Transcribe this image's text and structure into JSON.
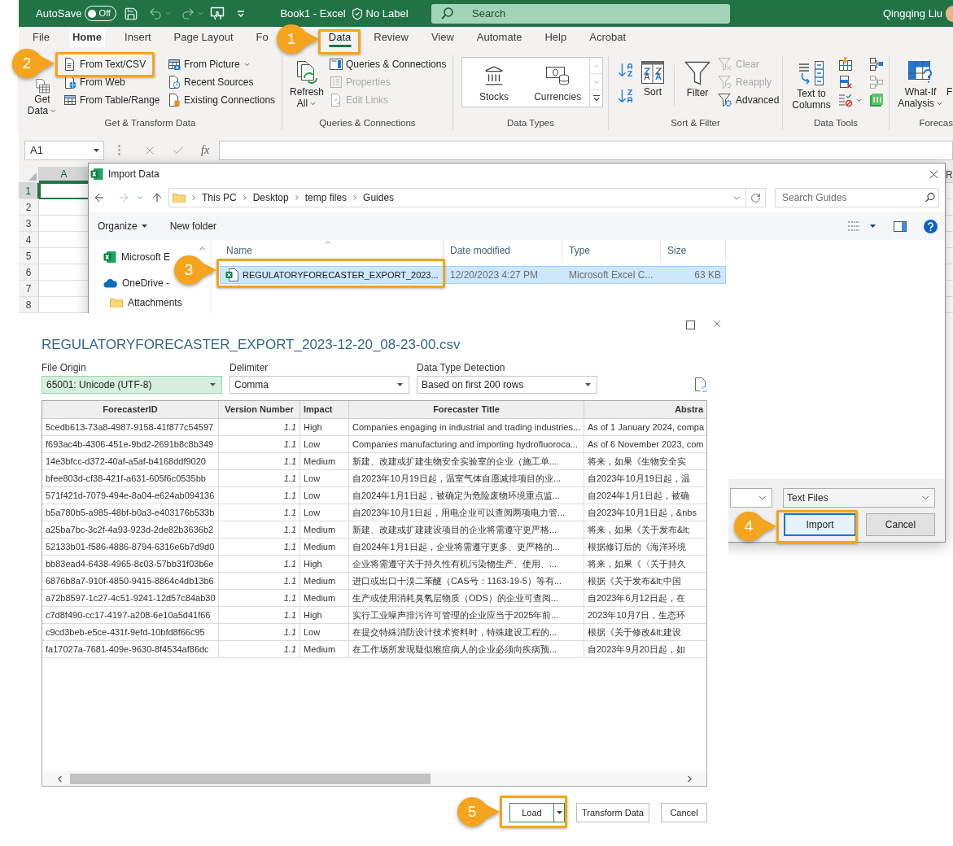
{
  "title_bar": {
    "autosave": {
      "label": "AutoSave",
      "state_text": "Off",
      "on": false
    },
    "document_title": "Book1 - Excel",
    "sensitivity": "No Label",
    "search_placeholder": "Search",
    "user_name": "Qingqing Liu"
  },
  "ribbon_tabs": [
    {
      "label": "File",
      "selected": false,
      "highlighted": false
    },
    {
      "label": "Home",
      "selected": false,
      "highlighted": true
    },
    {
      "label": "Insert",
      "selected": false,
      "highlighted": false
    },
    {
      "label": "Page Layout",
      "selected": false,
      "highlighted": false
    },
    {
      "label": "Fo",
      "selected": false,
      "highlighted": false
    },
    {
      "label": "Data",
      "selected": true,
      "highlighted": false
    },
    {
      "label": "Review",
      "selected": false,
      "highlighted": false
    },
    {
      "label": "View",
      "selected": false,
      "highlighted": false
    },
    {
      "label": "Automate",
      "selected": false,
      "highlighted": false
    },
    {
      "label": "Help",
      "selected": false,
      "highlighted": false
    },
    {
      "label": "Acrobat",
      "selected": false,
      "highlighted": false
    }
  ],
  "ribbon_groups": [
    {
      "kind": "get_transform",
      "label": "Get & Transform Data",
      "large": [
        {
          "label": "Get Data",
          "dropdown": true
        }
      ],
      "small": [
        {
          "label": "From Text/CSV"
        },
        {
          "label": "From Web"
        },
        {
          "label": "From Table/Range"
        },
        {
          "label": "From Picture",
          "dropdown": true
        },
        {
          "label": "Recent Sources"
        },
        {
          "label": "Existing Connections"
        }
      ]
    },
    {
      "kind": "queries",
      "label": "Queries & Connections",
      "large": [
        {
          "label": "Refresh All",
          "dropdown": true
        }
      ],
      "small": [
        {
          "label": "Queries & Connections",
          "disabled": false
        },
        {
          "label": "Properties",
          "disabled": true
        },
        {
          "label": "Edit Links",
          "disabled": true
        }
      ]
    },
    {
      "kind": "data_types",
      "label": "Data Types",
      "gallery": [
        {
          "label": "Stocks"
        },
        {
          "label": "Currencies"
        }
      ]
    },
    {
      "kind": "sort_filter",
      "label": "Sort & Filter",
      "large": [
        {
          "label": "Sort"
        },
        {
          "label": "Filter"
        }
      ],
      "small": [
        {
          "label": "Clear",
          "disabled": true
        },
        {
          "label": "Reapply",
          "disabled": true
        },
        {
          "label": "Advanced",
          "disabled": false
        }
      ]
    },
    {
      "kind": "data_tools",
      "label": "Data Tools",
      "large": [
        {
          "label": "Text to Columns"
        }
      ]
    },
    {
      "kind": "forecast",
      "label": "Forecas",
      "large": [
        {
          "label": "What-If Analysis",
          "dropdown": true
        },
        {
          "label": "F"
        }
      ]
    }
  ],
  "formula_bar": {
    "name_box": "A1",
    "function_label": "fx"
  },
  "grid": {
    "columns": [
      {
        "label": "A",
        "selected": true
      },
      {
        "label": "R",
        "selected": false
      }
    ],
    "rows": [
      {
        "label": "1",
        "selected": true
      },
      {
        "label": "2",
        "selected": false
      },
      {
        "label": "3",
        "selected": false
      },
      {
        "label": "4",
        "selected": false
      },
      {
        "label": "5",
        "selected": false
      },
      {
        "label": "6",
        "selected": false
      },
      {
        "label": "7",
        "selected": false
      },
      {
        "label": "8",
        "selected": false
      }
    ]
  },
  "import_dialog": {
    "title": "Import Data",
    "path": [
      "This PC",
      "Desktop",
      "temp files",
      "Guides"
    ],
    "search_placeholder": "Search Guides",
    "toolbar": [
      {
        "label": "Organize",
        "dropdown": true
      },
      {
        "label": "New folder"
      }
    ],
    "nav_items": [
      {
        "kind": "excel",
        "label": "Microsoft E"
      },
      {
        "kind": "cloud",
        "label": "OneDrive -"
      },
      {
        "kind": "folder",
        "label": "Attachments"
      }
    ],
    "columns": [
      "Name",
      "Date modified",
      "Type",
      "Size"
    ],
    "files": [
      {
        "name": "REGULATORYFORECASTER_EXPORT_2023...",
        "date_modified": "12/20/2023 4:27 PM",
        "type": "Microsoft Excel C...",
        "size": "63 KB",
        "selected": true
      }
    ],
    "file_type": "Text Files",
    "buttons": [
      {
        "label": "Import",
        "focused": true
      },
      {
        "label": "Cancel",
        "focused": false
      }
    ]
  },
  "preview_dialog": {
    "title": "REGULATORYFORECASTER_EXPORT_2023-12-20_08-23-00.csv",
    "options": [
      {
        "label": "File Origin",
        "value": "65001: Unicode (UTF-8)",
        "highlighted": true
      },
      {
        "label": "Delimiter",
        "value": "Comma",
        "highlighted": false
      },
      {
        "label": "Data Type Detection",
        "value": "Based on first 200 rows",
        "highlighted": false
      }
    ],
    "table": {
      "columns": [
        "ForecasterID",
        "Version Number",
        "Impact",
        "Forecaster Title",
        "Abstra"
      ],
      "rows": [
        [
          "5cedb613-73a8-4987-9158-41f877c54597",
          "1.1",
          "High",
          "Companies engaging in industrial and trading industries...",
          "As of 1 January 2024, compa"
        ],
        [
          "f693ac4b-4306-451e-9bd2-2691b8c8b349",
          "1.1",
          "Low",
          "Companies manufacturing and importing hydrofluoroca...",
          "As of 6 November 2023, com"
        ],
        [
          "14e3bfcc-d372-40af-a5af-b4168ddf9020",
          "1.1",
          "Medium",
          "新建、改建或扩建生物安全实验室的企业（施工单...",
          "将来，如果《生物安全实"
        ],
        [
          "bfee803d-cf38-421f-a631-605f6c0535bb",
          "1.1",
          "Low",
          "自2023年10月19日起，温室气体自愿减排项目的业...",
          "自2023年10月19日起，温"
        ],
        [
          "571f421d-7079-494e-8a04-e624ab094136",
          "1.1",
          "Low",
          "自2024年1月1日起，被确定为危险废物环境重点监...",
          "自2024年1月1日起，被确"
        ],
        [
          "b5a780b5-a985-48bf-b0a3-e403176b533b",
          "1.1",
          "Low",
          "自2023年10月1日起，用电企业可以查阅两项电力管...",
          "自2023年10月1日起，&nbs"
        ],
        [
          "a25ba7bc-3c2f-4a93-923d-2de82b3636b2",
          "1.1",
          "Medium",
          "新建、改建或扩建建设项目的企业将需遵守更严格...",
          "将来，如果《关于发布&lt;"
        ],
        [
          "52133b01-f586-4886-8794-6316e6b7d9d0",
          "1.1",
          "Medium",
          "自2024年1月1日起，企业将需遵守更多、更严格的...",
          "根据修订后的《海洋环境"
        ],
        [
          "bb83ead4-6438-4965-8c03-57bb31f03b6e",
          "1.1",
          "High",
          "企业将需遵守关于持久性有机污染物生产、使用、...",
          "将来，如果《〈关于持久"
        ],
        [
          "6876b8a7-910f-4850-9415-8864c4db13b6",
          "1.1",
          "Medium",
          "进口或出口十溴二苯醚（CAS号：1163-19-5）等有...",
          "根据《关于发布&lt;中国"
        ],
        [
          "a72b8597-1c27-4c51-9241-12d57c84ab30",
          "1.1",
          "Medium",
          "生产或使用消耗臭氧层物质（ODS）的企业可查阅...",
          "自2023年6月12日起，在"
        ],
        [
          "c7d8f490-cc17-4197-a208-6e10a5d41f66",
          "1.1",
          "High",
          "实行工业噪声排污许可管理的企业应当于2025年前...",
          "2023年10月7日，生态环"
        ],
        [
          "c9cd3beb-e5ce-431f-9efd-10bfd8f66c95",
          "1.1",
          "Low",
          "在提交特殊消防设计技术资料时，特殊建设工程的...",
          "根据《关于修改&lt;建设"
        ],
        [
          "fa17027a-7681-409e-9630-8f4534af86dc",
          "1.1",
          "Medium",
          "在工作场所发现疑似猴痘病人的企业必须向疾病预...",
          "自2023年9月20日起，如"
        ]
      ]
    },
    "buttons": [
      {
        "kind": "split",
        "label": "Load"
      },
      {
        "kind": "plain",
        "label": "Transform Data"
      },
      {
        "kind": "plain",
        "label": "Cancel"
      }
    ]
  },
  "callouts": [
    {
      "number": "1"
    },
    {
      "number": "2"
    },
    {
      "number": "3"
    },
    {
      "number": "4"
    },
    {
      "number": "5"
    }
  ]
}
